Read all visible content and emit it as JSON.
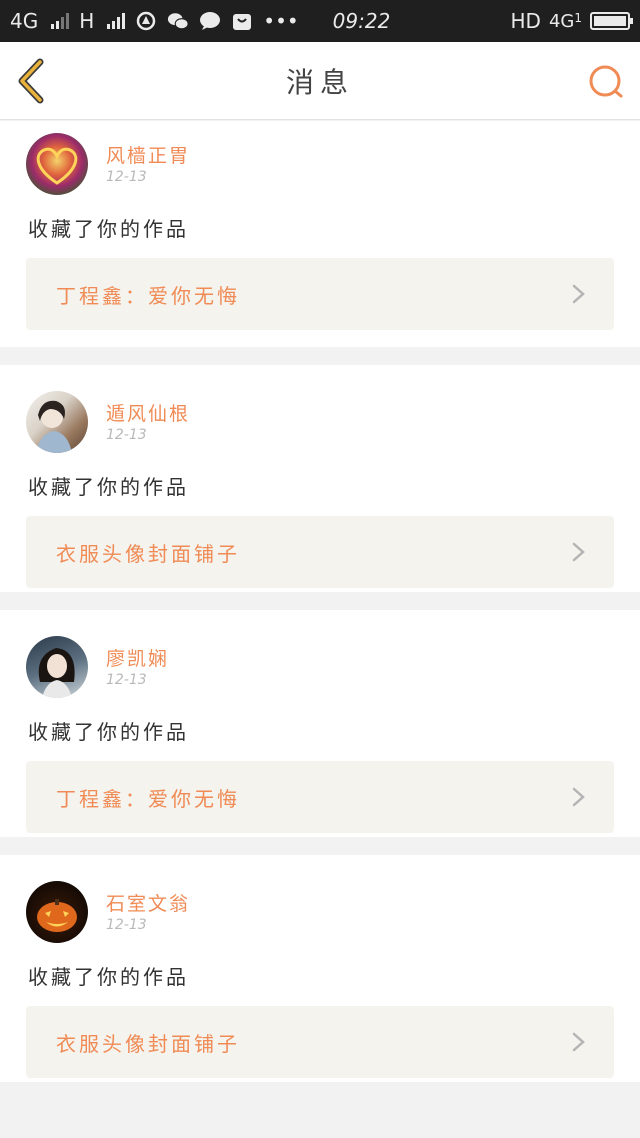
{
  "status_bar": {
    "network_left": "4G",
    "network_h": "H",
    "time": "09:22",
    "hd": "HD",
    "network_right": "4G",
    "sim_index": "1",
    "dots": "•••"
  },
  "header": {
    "title": "消息"
  },
  "colors": {
    "accent": "#f08b55",
    "nav_back": "#e8b23c",
    "card_box": "#f4f3ee"
  },
  "messages": [
    {
      "user": "风樯正胃",
      "date": "12-13",
      "action": "收藏了你的作品",
      "work": "丁程鑫：爱你无悔"
    },
    {
      "user": "遁风仙根",
      "date": "12-13",
      "action": "收藏了你的作品",
      "work": "衣服头像封面铺子"
    },
    {
      "user": "廖凯娴",
      "date": "12-13",
      "action": "收藏了你的作品",
      "work": "丁程鑫：爱你无悔"
    },
    {
      "user": "石室文翁",
      "date": "12-13",
      "action": "收藏了你的作品",
      "work": "衣服头像封面铺子"
    }
  ]
}
